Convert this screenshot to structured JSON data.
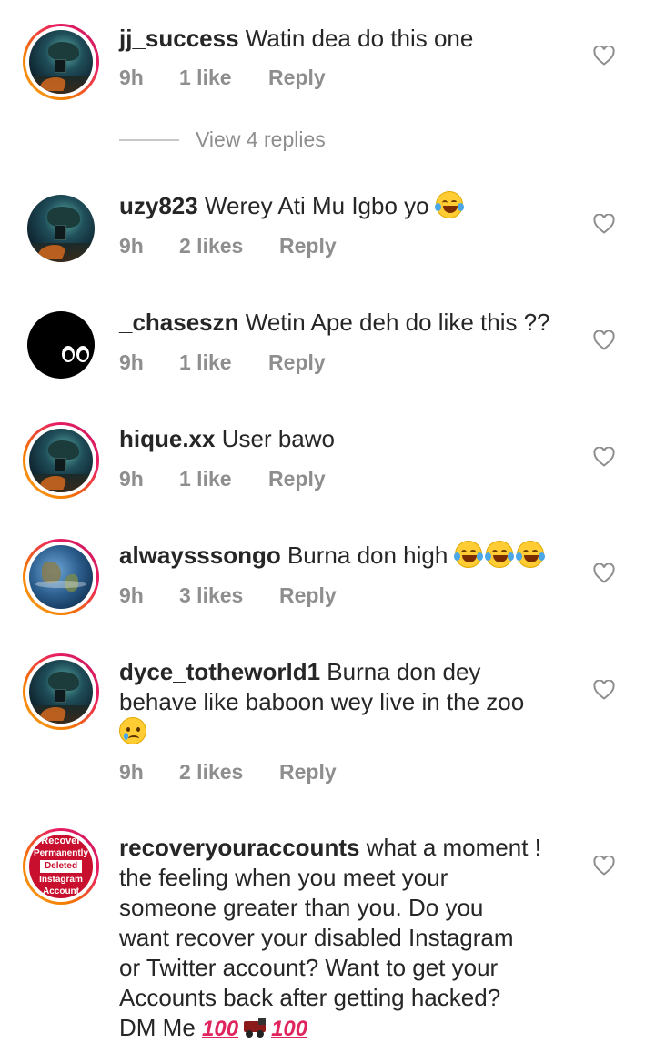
{
  "comments": [
    {
      "username": "jj_success",
      "text": "Watin dea do this one",
      "time": "9h",
      "likes": "1 like",
      "reply": "Reply",
      "avatar": "scene-story",
      "view_replies": "View 4 replies"
    },
    {
      "username": "uzy823",
      "text": "Werey Ati Mu Igbo yo",
      "emoji": [
        "face-with-tears-of-joy"
      ],
      "time": "9h",
      "likes": "2 likes",
      "reply": "Reply",
      "avatar": "scene"
    },
    {
      "username": "_chaseszn",
      "text": "Wetin Ape deh do like this ??",
      "time": "9h",
      "likes": "1 like",
      "reply": "Reply",
      "avatar": "black-eyes"
    },
    {
      "username": "hique.xx",
      "text": "User bawo",
      "time": "9h",
      "likes": "1 like",
      "reply": "Reply",
      "avatar": "scene-story"
    },
    {
      "username": "alwaysssongo",
      "text": "Burna don high",
      "emoji": [
        "face-with-tears-of-joy",
        "face-with-tears-of-joy",
        "face-with-tears-of-joy"
      ],
      "time": "9h",
      "likes": "3 likes",
      "reply": "Reply",
      "avatar": "earth-story"
    },
    {
      "username": "dyce_totheworld1",
      "text_line1": "Burna don dey",
      "text_line2": "behave like baboon wey live in the zoo",
      "emoji": [
        "crying-face"
      ],
      "time": "9h",
      "likes": "2 likes",
      "reply": "Reply",
      "avatar": "scene-story"
    },
    {
      "username": "recoveryouraccounts",
      "text_line1": "what a moment !",
      "text_line2": "the feeling when you meet your",
      "text_line3": "someone greater than you. Do you",
      "text_line4": "want recover your disabled Instagram",
      "text_line5": "or Twitter account? Want to get your",
      "text_line6": "Accounts back after getting hacked?",
      "text_line7": "DM  Me",
      "emoji": [
        "hundred-points",
        "locomotive",
        "hundred-points"
      ],
      "hundred": "100",
      "avatar_text": {
        "line1": "Recover",
        "line2": "Permanently",
        "line3": "Deleted",
        "line4": "Instagram",
        "line5": "Account"
      },
      "avatar": "recover-story"
    }
  ],
  "icons": {
    "like": "heart-outline-icon"
  }
}
